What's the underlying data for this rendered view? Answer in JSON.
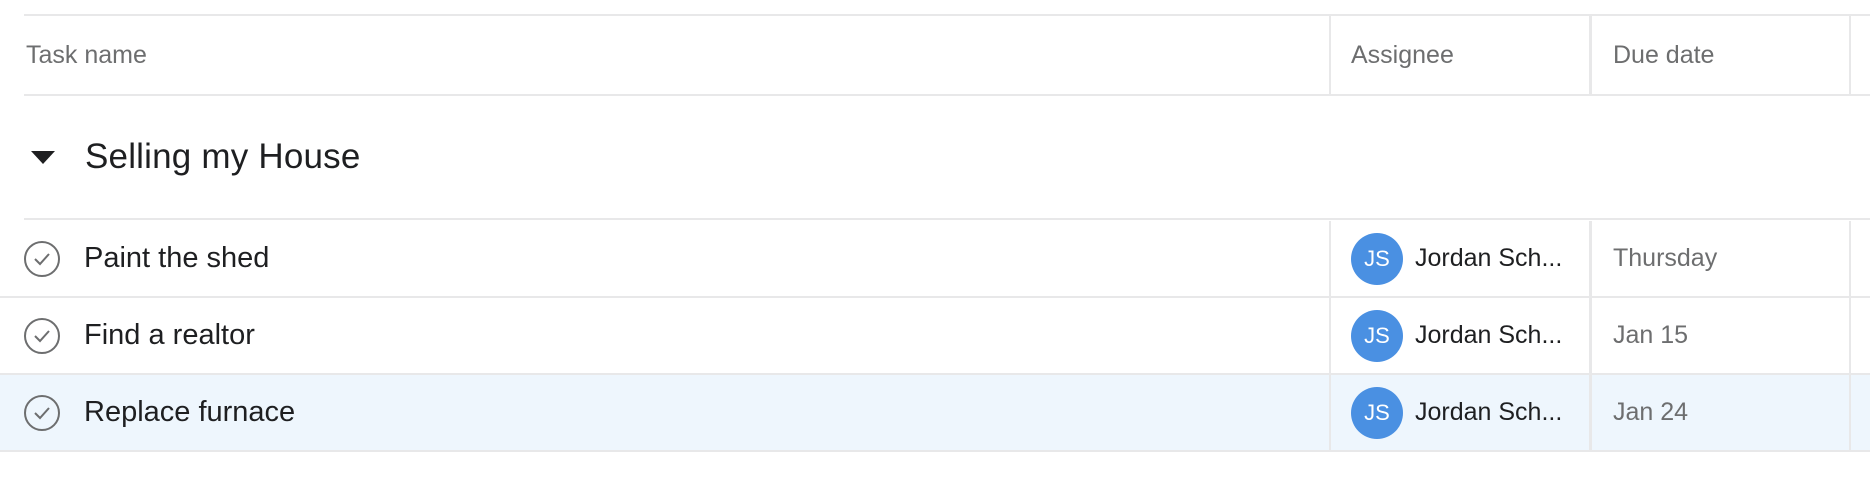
{
  "header": {
    "task_name": "Task name",
    "assignee": "Assignee",
    "due_date": "Due date"
  },
  "section": {
    "title": "Selling my House"
  },
  "tasks": [
    {
      "name": "Paint the shed",
      "assignee_initials": "JS",
      "assignee_name": "Jordan Sch...",
      "due": "Thursday",
      "highlighted": false
    },
    {
      "name": "Find a realtor",
      "assignee_initials": "JS",
      "assignee_name": "Jordan Sch...",
      "due": "Jan 15",
      "highlighted": false
    },
    {
      "name": "Replace furnace",
      "assignee_initials": "JS",
      "assignee_name": "Jordan Sch...",
      "due": "Jan 24",
      "highlighted": true
    }
  ],
  "icons": {
    "section_toggle": "caret-down-icon",
    "complete_check": "check-circle-icon"
  },
  "colors": {
    "avatar_bg": "#4a90e2",
    "row_highlight": "#eef6fd",
    "border": "#e8e8e9",
    "muted_text": "#6d6e6f"
  }
}
